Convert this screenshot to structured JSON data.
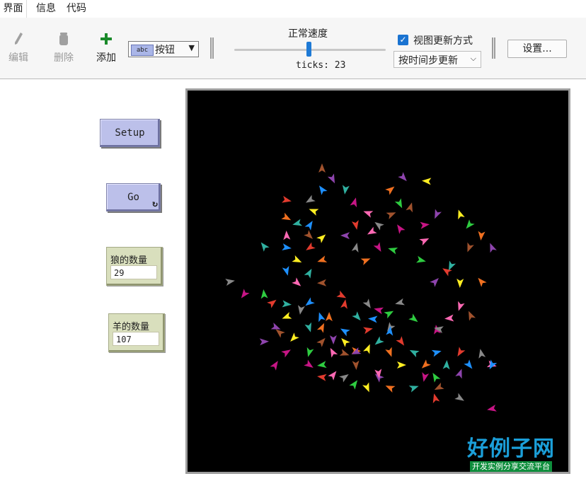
{
  "tabs": [
    "界面",
    "信息",
    "代码"
  ],
  "toolbar": {
    "edit_label": "编辑",
    "delete_label": "删除",
    "add_label": "添加",
    "widget_type": "按钮",
    "widget_icon_text": "abc",
    "speed_label": "正常速度",
    "speed_fraction": 0.49,
    "ticks_text": "ticks: 23",
    "view_update_checked": true,
    "view_update_label": "视图更新方式",
    "update_mode": "按时间步更新",
    "settings_label": "设置..."
  },
  "buttons": {
    "setup_label": "Setup",
    "go_label": "Go",
    "go_icon": "forever-loop-icon"
  },
  "monitors": [
    {
      "label": "狼的数量",
      "value": "29"
    },
    {
      "label": "羊的数量",
      "value": "107"
    }
  ],
  "watermark": {
    "title": "好例子网",
    "subtitle": "开发实例分享交流平台"
  },
  "colors": {
    "button": "#bcc0ea",
    "monitor": "#d9dfbd",
    "accent": "#1e7ad6",
    "agents": [
      "#2ecc40",
      "#e23b2e",
      "#f07020",
      "#a0522d",
      "#c71585",
      "#1e90ff",
      "#ffee22",
      "#ff69b4",
      "#888888",
      "#30b0a0",
      "#8e44ad"
    ]
  }
}
